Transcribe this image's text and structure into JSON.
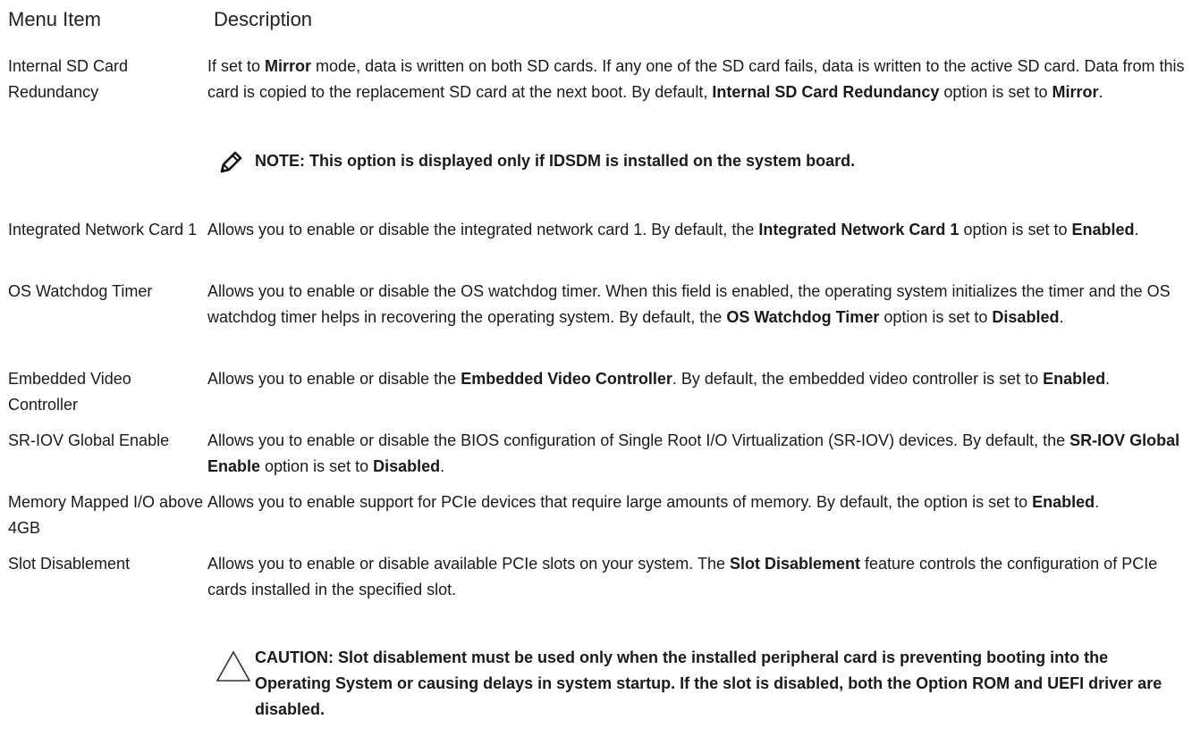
{
  "header": {
    "col_term": "Menu Item",
    "col_desc": "Description"
  },
  "rows": [
    {
      "term": "Internal SD Card Redundancy",
      "desc": [
        {
          "t": "If set to "
        },
        {
          "t": "Mirror",
          "b": true
        },
        {
          "t": " mode, data is written on both SD cards. If any one of the SD card fails, data is written to the active SD card. Data from this card is copied to the replacement SD card at the next boot. By default, "
        },
        {
          "t": "Internal SD Card Redundancy",
          "b": true
        },
        {
          "t": " option is set to "
        },
        {
          "t": "Mirror",
          "b": true
        },
        {
          "t": "."
        }
      ]
    },
    {
      "term": "Integrated Network Card 1",
      "desc": [
        {
          "t": "Allows you to enable or disable the integrated network card 1. By default, the "
        },
        {
          "t": "Integrated Network Card 1",
          "b": true
        },
        {
          "t": " option is set to "
        },
        {
          "t": "Enabled",
          "b": true
        },
        {
          "t": "."
        }
      ]
    },
    {
      "term": "OS Watchdog Timer",
      "desc": [
        {
          "t": "Allows you to enable or disable the OS watchdog timer. When this field is enabled, the operating system initializes the timer and the OS watchdog timer helps in recovering the operating system. By default, the "
        },
        {
          "t": "OS Watchdog Timer",
          "b": true
        },
        {
          "t": " option is set to "
        },
        {
          "t": "Disabled",
          "b": true
        },
        {
          "t": "."
        }
      ]
    },
    {
      "term": "Embedded Video Controller",
      "desc": [
        {
          "t": "Allows you to enable or disable the "
        },
        {
          "t": "Embedded Video Controller",
          "b": true
        },
        {
          "t": ". By default, the embedded video controller is set to "
        },
        {
          "t": "Enabled",
          "b": true
        },
        {
          "t": "."
        }
      ]
    },
    {
      "term": "SR-IOV Global Enable",
      "desc": [
        {
          "t": "Allows you to enable or disable the BIOS configuration of Single Root I/O Virtualization (SR-IOV) devices. By default, the "
        },
        {
          "t": "SR-IOV Global Enable",
          "b": true
        },
        {
          "t": " option is set to "
        },
        {
          "t": "Disabled",
          "b": true
        },
        {
          "t": "."
        }
      ]
    },
    {
      "term": "Memory Mapped I/O above 4GB",
      "desc": [
        {
          "t": "Allows you to enable support for PCIe devices that require large amounts of memory. By default, the option is set to "
        },
        {
          "t": "Enabled",
          "b": true
        },
        {
          "t": "."
        }
      ]
    },
    {
      "term": "Slot Disablement",
      "desc": [
        {
          "t": "Allows you to enable or disable available PCIe slots on your system. The "
        },
        {
          "t": "Slot Disablement",
          "b": true
        },
        {
          "t": " feature controls the configuration of PCIe cards installed in the specified slot."
        }
      ]
    }
  ],
  "note": {
    "icon": "note-pencil-icon",
    "text": "NOTE: This option is displayed only if IDSDM is installed on the system board."
  },
  "caution": {
    "icon": "caution-triangle-icon",
    "text": "CAUTION: Slot disablement must be used only when the installed peripheral card is preventing booting into the Operating System or causing delays in system startup. If the slot is disabled, both the Option ROM and UEFI driver are disabled."
  }
}
